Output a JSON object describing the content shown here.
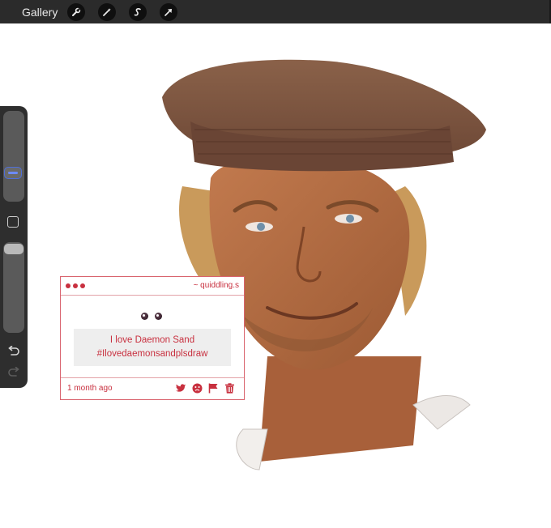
{
  "toolbar": {
    "gallery_label": "Gallery",
    "tools": [
      {
        "icon": "wrench-icon"
      },
      {
        "icon": "magic-wand-icon"
      },
      {
        "icon": "selection-s-icon"
      },
      {
        "icon": "arrow-cursor-icon"
      }
    ]
  },
  "sidebar": {
    "brush_size_level": 0.62,
    "opacity_level": 0.0
  },
  "comment": {
    "author": "~ quiddling.s",
    "message_line1": "I love Daemon Sand",
    "message_line2": "#Ilovedaemonsandplsdraw",
    "time": "1 month ago",
    "accent_color": "#c8303f"
  }
}
